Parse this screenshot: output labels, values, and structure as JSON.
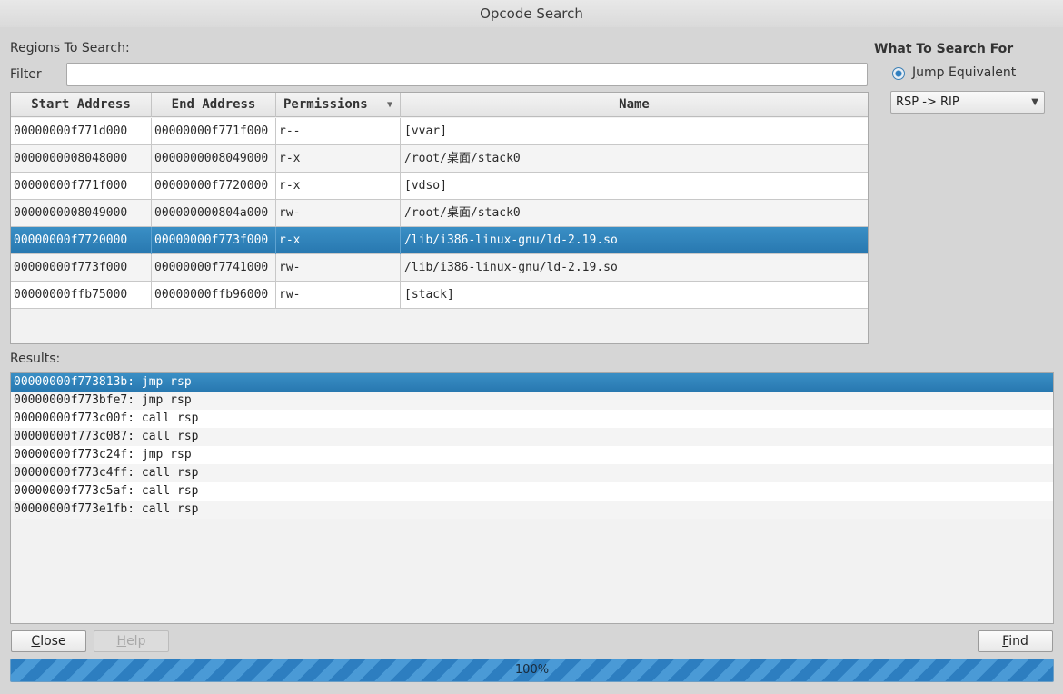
{
  "window": {
    "title": "Opcode Search"
  },
  "regions": {
    "label": "Regions To Search:",
    "filter_label": "Filter",
    "filter_value": "",
    "columns": [
      "Start Address",
      "End Address",
      "Permissions",
      "Name"
    ],
    "sort_indicator": "▼",
    "rows": [
      [
        "00000000f771d000",
        "00000000f771f000",
        "r--",
        "[vvar]"
      ],
      [
        "0000000008048000",
        "0000000008049000",
        "r-x",
        "/root/桌面/stack0"
      ],
      [
        "00000000f771f000",
        "00000000f7720000",
        "r-x",
        "[vdso]"
      ],
      [
        "0000000008049000",
        "000000000804a000",
        "rw-",
        "/root/桌面/stack0"
      ],
      [
        "00000000f7720000",
        "00000000f773f000",
        "r-x",
        "/lib/i386-linux-gnu/ld-2.19.so"
      ],
      [
        "00000000f773f000",
        "00000000f7741000",
        "rw-",
        "/lib/i386-linux-gnu/ld-2.19.so"
      ],
      [
        "00000000ffb75000",
        "00000000ffb96000",
        "rw-",
        "[stack]"
      ]
    ],
    "selected_row": 4
  },
  "search_for": {
    "title": "What To Search For",
    "option_label": "Jump Equivalent",
    "selected_value": "RSP -> RIP",
    "dropdown_arrow": "▼"
  },
  "results": {
    "label": "Results:",
    "items": [
      "00000000f773813b: jmp rsp",
      "00000000f773bfe7: jmp rsp",
      "00000000f773c00f: call rsp",
      "00000000f773c087: call rsp",
      "00000000f773c24f: jmp rsp",
      "00000000f773c4ff: call rsp",
      "00000000f773c5af: call rsp",
      "00000000f773e1fb: call rsp"
    ],
    "selected_item": 0
  },
  "buttons": {
    "close": "Close",
    "help": "Help",
    "find": "Find"
  },
  "progress": {
    "value": 1.0,
    "text": "100%"
  }
}
